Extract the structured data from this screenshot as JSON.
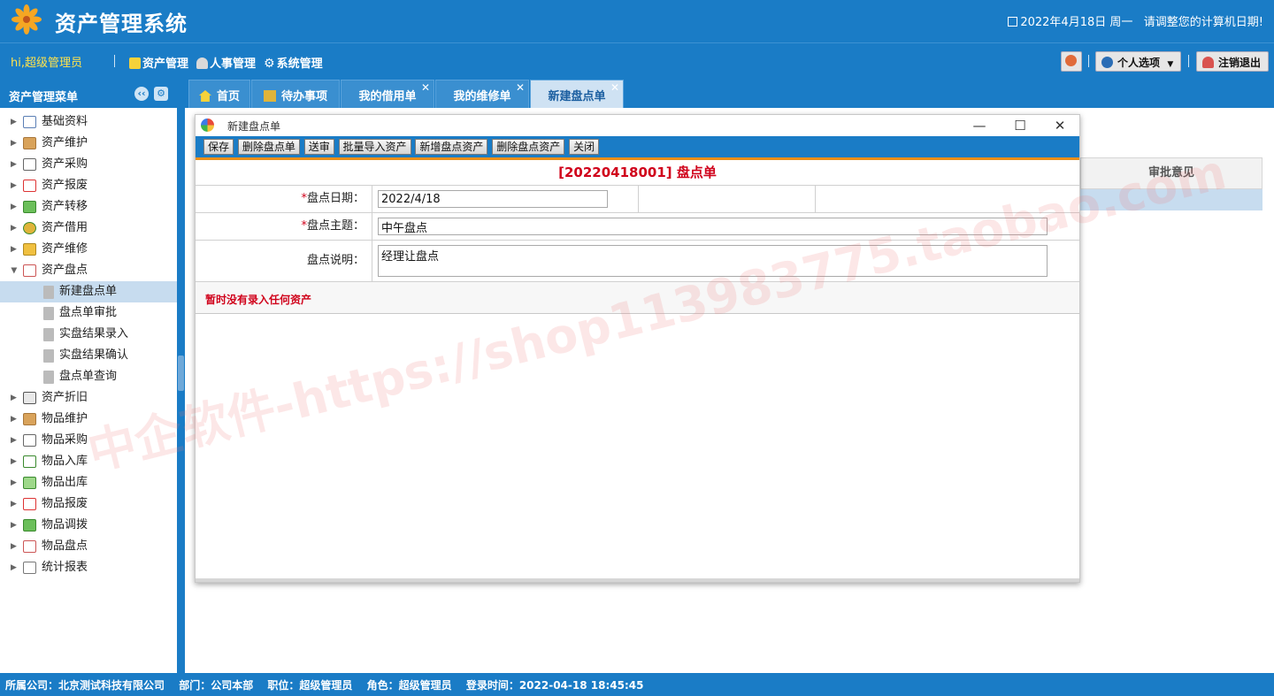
{
  "app": {
    "title": "资产管理系统"
  },
  "header": {
    "date": "2022年4月18日 周一",
    "notice": "请调整您的计算机日期!"
  },
  "topnav": {
    "greeting": "hi,超级管理员",
    "menus": [
      {
        "label": "资产管理",
        "icon": "folder-icon"
      },
      {
        "label": "人事管理",
        "icon": "person-icon"
      },
      {
        "label": "系统管理",
        "icon": "gear-icon"
      }
    ],
    "personal_options": "个人选项",
    "logout": "注销退出"
  },
  "sidebar": {
    "title": "资产管理菜单",
    "items": [
      {
        "label": "基础资料"
      },
      {
        "label": "资产维护"
      },
      {
        "label": "资产采购"
      },
      {
        "label": "资产报废"
      },
      {
        "label": "资产转移"
      },
      {
        "label": "资产借用"
      },
      {
        "label": "资产维修"
      },
      {
        "label": "资产盘点"
      },
      {
        "label": "新建盘点单"
      },
      {
        "label": "盘点单审批"
      },
      {
        "label": "实盘结果录入"
      },
      {
        "label": "实盘结果确认"
      },
      {
        "label": "盘点单查询"
      },
      {
        "label": "资产折旧"
      },
      {
        "label": "物品维护"
      },
      {
        "label": "物品采购"
      },
      {
        "label": "物品入库"
      },
      {
        "label": "物品出库"
      },
      {
        "label": "物品报废"
      },
      {
        "label": "物品调拨"
      },
      {
        "label": "物品盘点"
      },
      {
        "label": "统计报表"
      }
    ]
  },
  "tabs": [
    {
      "label": "首页"
    },
    {
      "label": "待办事项"
    },
    {
      "label": "我的借用单"
    },
    {
      "label": "我的维修单"
    },
    {
      "label": "新建盘点单"
    }
  ],
  "background_table": {
    "header": "审批意见"
  },
  "dialog": {
    "title": "新建盘点单",
    "toolbar": [
      "保存",
      "删除盘点单",
      "送审",
      "批量导入资产",
      "新增盘点资产",
      "删除盘点资产",
      "关闭"
    ],
    "doc_title": "[20220418001] 盘点单",
    "required_mark": "*",
    "fields": {
      "date_label": "盘点日期：",
      "date_value": "2022/4/18",
      "subject_label": "盘点主题：",
      "subject_value": "中午盘点",
      "desc_label": "盘点说明：",
      "desc_value": "经理让盘点"
    },
    "empty_notice": "暂时没有录入任何资产"
  },
  "watermark": "中企软件-https://shop113983775.taobao.com",
  "status": {
    "company": "所属公司：北京测试科技有限公司",
    "dept": "部门：公司本部",
    "position": "职位：超级管理员",
    "role": "角色：超级管理员",
    "login": "登录时间：2022-04-18 18:45:45"
  },
  "colors": {
    "primary": "#1a7cc6",
    "accent": "#e98e1a",
    "alert": "#d0021b",
    "greeting": "#ffe34d"
  }
}
